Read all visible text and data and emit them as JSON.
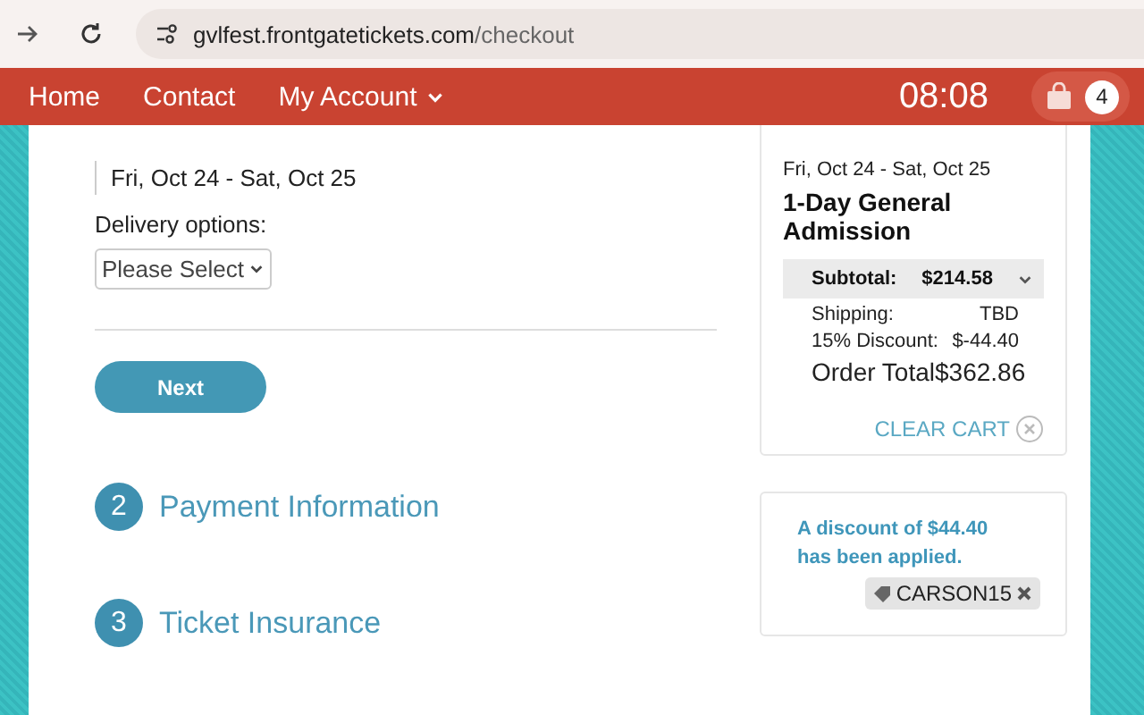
{
  "browser": {
    "url_host": "gvlfest.frontgatetickets.com",
    "url_path": "/checkout"
  },
  "nav": {
    "items": [
      {
        "label": "Home",
        "dropdown": false
      },
      {
        "label": "Contact",
        "dropdown": false
      },
      {
        "label": "My Account",
        "dropdown": true
      }
    ],
    "timer": "08:08",
    "cart_count": "4"
  },
  "checkout": {
    "date_range": "Fri, Oct 24 - Sat, Oct 25",
    "delivery_label": "Delivery options:",
    "delivery_select": "Please Select",
    "next_button": "Next",
    "steps": [
      {
        "number": "2",
        "title": "Payment Information"
      },
      {
        "number": "3",
        "title": "Ticket Insurance"
      }
    ]
  },
  "cart": {
    "date_range": "Fri, Oct 24 - Sat, Oct 25",
    "ticket": "1-Day General Admission",
    "subtotal_label": "Subtotal:",
    "subtotal": "$214.58",
    "expanded": true,
    "lines": [
      {
        "label": "Shipping:",
        "value": "TBD"
      },
      {
        "label": "15% Discount:",
        "value": "$-44.40"
      }
    ],
    "total_label": "Order Total",
    "total": "$362.86",
    "clear_cart": "CLEAR CART"
  },
  "discount": {
    "message": "A discount of $44.40 has been applied.",
    "code": "CARSON15"
  }
}
